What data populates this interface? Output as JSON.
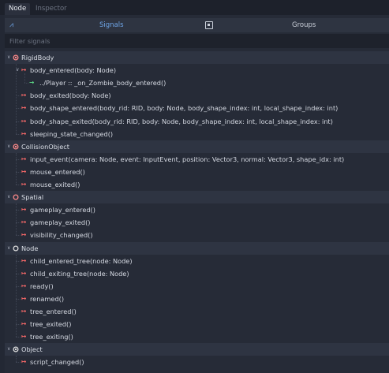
{
  "tabs": [
    "Node",
    "Inspector"
  ],
  "modes": {
    "signals": "Signals",
    "groups": "Groups"
  },
  "filter": {
    "placeholder": "Filter signals"
  },
  "classes": [
    {
      "name": "RigidBody",
      "icon": "rigidbody-icon",
      "color": "#ff8a8a",
      "signals": [
        {
          "text": "body_entered(body: Node)",
          "expanded": true,
          "connections": [
            "../Player :: _on_Zombie_body_entered()"
          ]
        },
        {
          "text": "body_exited(body: Node)"
        },
        {
          "text": "body_shape_entered(body_rid: RID, body: Node, body_shape_index: int, local_shape_index: int)"
        },
        {
          "text": "body_shape_exited(body_rid: RID, body: Node, body_shape_index: int, local_shape_index: int)"
        },
        {
          "text": "sleeping_state_changed()"
        }
      ]
    },
    {
      "name": "CollisionObject",
      "icon": "collisionobject-icon",
      "color": "#ff8a8a",
      "signals": [
        {
          "text": "input_event(camera: Node, event: InputEvent, position: Vector3, normal: Vector3, shape_idx: int)"
        },
        {
          "text": "mouse_entered()"
        },
        {
          "text": "mouse_exited()"
        }
      ]
    },
    {
      "name": "Spatial",
      "icon": "spatial-icon",
      "color": "#ff8a8a",
      "signals": [
        {
          "text": "gameplay_entered()"
        },
        {
          "text": "gameplay_exited()"
        },
        {
          "text": "visibility_changed()"
        }
      ]
    },
    {
      "name": "Node",
      "icon": "node-icon",
      "color": "#e0e0e0",
      "signals": [
        {
          "text": "child_entered_tree(node: Node)"
        },
        {
          "text": "child_exiting_tree(node: Node)"
        },
        {
          "text": "ready()"
        },
        {
          "text": "renamed()"
        },
        {
          "text": "tree_entered()"
        },
        {
          "text": "tree_exited()"
        },
        {
          "text": "tree_exiting()"
        }
      ]
    },
    {
      "name": "Object",
      "icon": "object-icon",
      "color": "#e0e0e0",
      "signals": [
        {
          "text": "script_changed()"
        }
      ]
    }
  ]
}
